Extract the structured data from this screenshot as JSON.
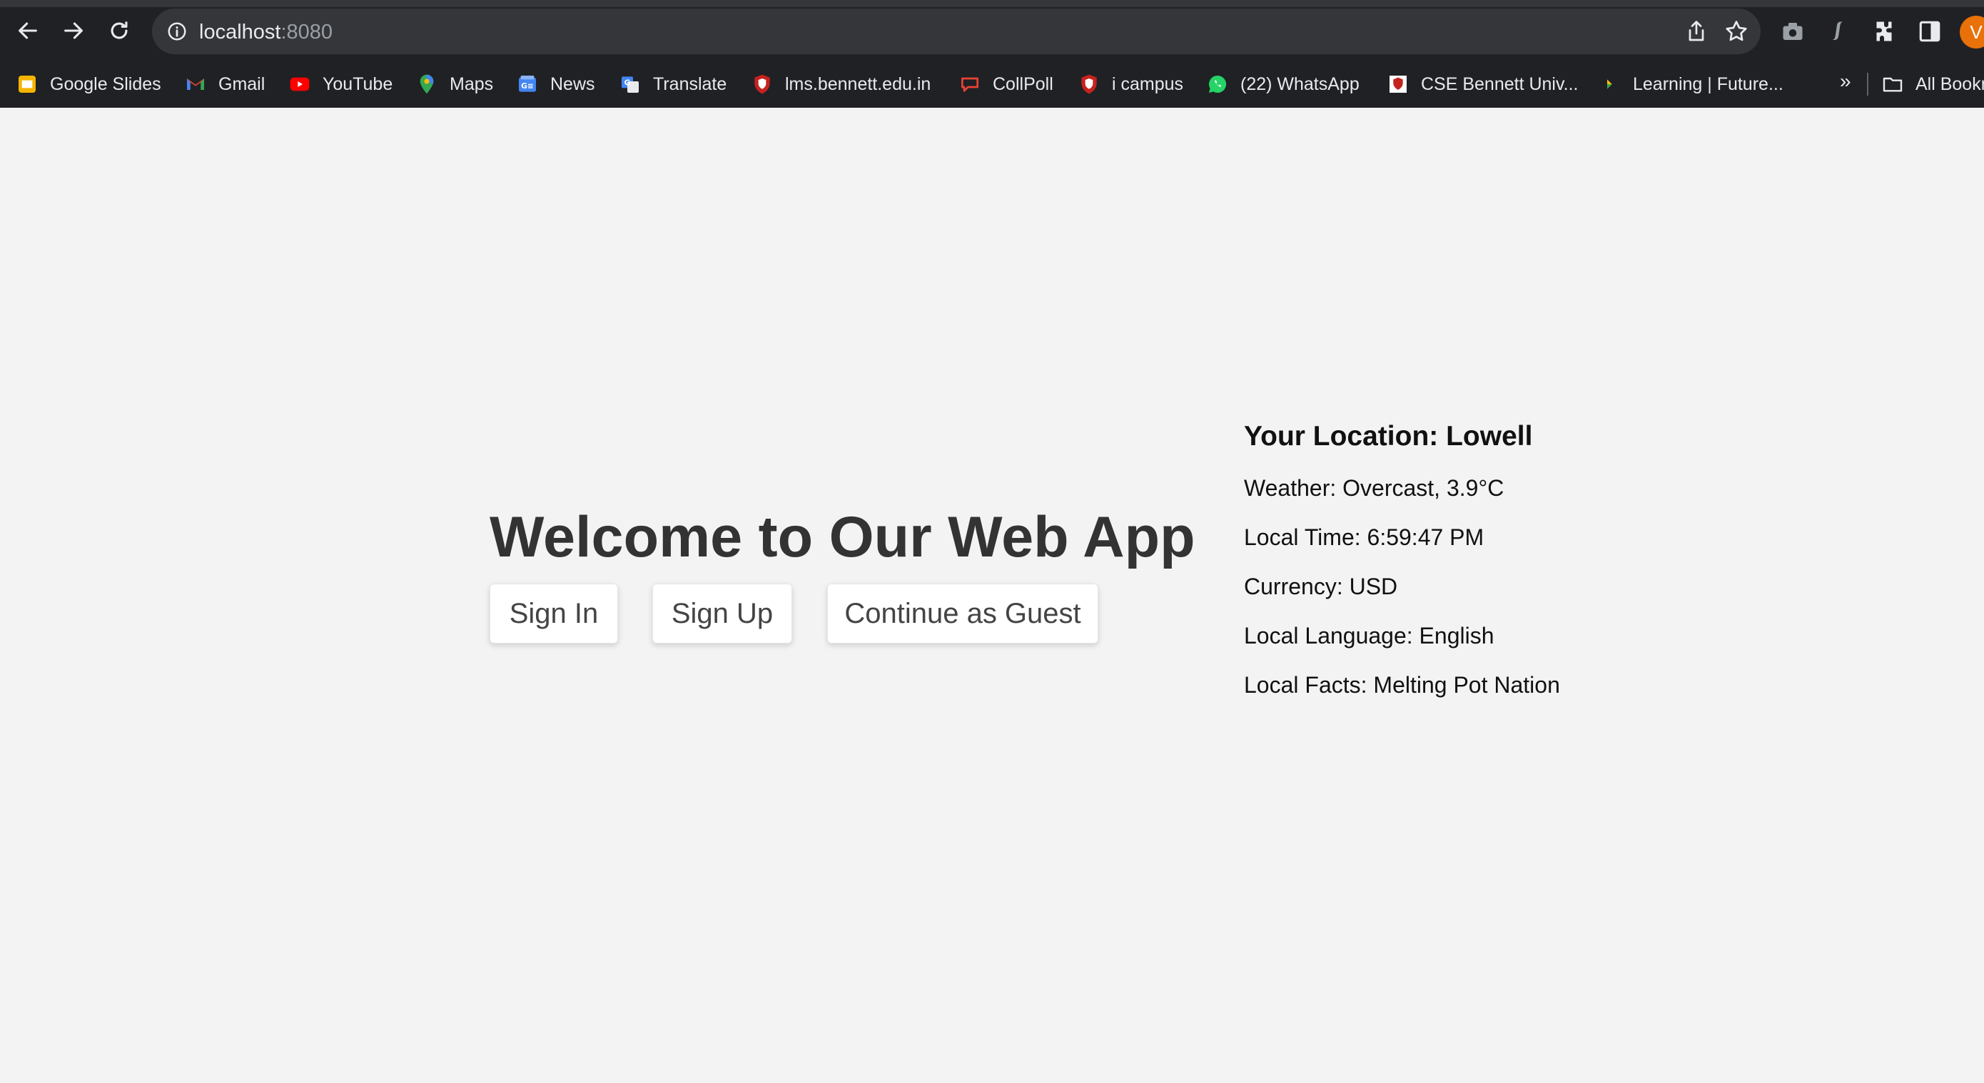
{
  "browser": {
    "url_host": "localhost",
    "url_port": ":8080",
    "avatar_letter": "V",
    "bookmarks": [
      {
        "label": "Google Slides",
        "icon": "slides-icon"
      },
      {
        "label": "Gmail",
        "icon": "gmail-icon"
      },
      {
        "label": "YouTube",
        "icon": "youtube-icon"
      },
      {
        "label": "Maps",
        "icon": "maps-icon"
      },
      {
        "label": "News",
        "icon": "news-icon"
      },
      {
        "label": "Translate",
        "icon": "translate-icon"
      },
      {
        "label": "lms.bennett.edu.in",
        "icon": "bennett-shield-icon"
      },
      {
        "label": "CollPoll",
        "icon": "collpoll-icon"
      },
      {
        "label": "i campus",
        "icon": "bennett-shield-icon"
      },
      {
        "label": "(22) WhatsApp",
        "icon": "whatsapp-icon"
      },
      {
        "label": "CSE Bennett Univ...",
        "icon": "bennett-shield-icon"
      },
      {
        "label": "Learning | Future...",
        "icon": "learning-icon"
      }
    ],
    "more_label": "»",
    "all_bookmarks_label": "All Bookmarks"
  },
  "page": {
    "title": "Welcome to Our Web App",
    "buttons": {
      "sign_in": "Sign In",
      "sign_up": "Sign Up",
      "guest": "Continue as Guest"
    }
  },
  "location": {
    "heading": "Your Location: Lowell",
    "weather": "Weather: Overcast, 3.9°C",
    "time": "Local Time: 6:59:47 PM",
    "currency": "Currency: USD",
    "language": "Local Language: English",
    "facts": "Local Facts: Melting Pot Nation"
  },
  "colors": {
    "chrome_bg": "#202124",
    "omnibox_bg": "#35363a",
    "page_bg": "#f3f3f3",
    "avatar": "#e8710a"
  }
}
